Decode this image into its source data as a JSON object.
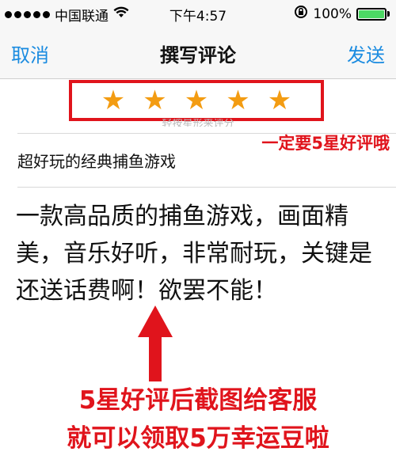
{
  "status_bar": {
    "carrier": "中国联通",
    "time": "下午4:57",
    "battery_percent": "100%",
    "battery_level": 1.0,
    "signal_dots": 5,
    "icons": [
      "wifi-icon",
      "rotation-lock-icon",
      "battery-icon"
    ]
  },
  "nav": {
    "cancel_label": "取消",
    "title": "撰写评论",
    "send_label": "发送"
  },
  "rating": {
    "stars": 5,
    "max_stars": 5,
    "hint": "轻按星形来评分",
    "star_color": "#f39c12",
    "highlight_color": "#e0141c"
  },
  "review": {
    "title": "超好玩的经典捕鱼游戏",
    "body": "一款高品质的捕鱼游戏，画面精美，音乐好听，非常耐玩，关键是还送话费啊！欲罢不能！"
  },
  "annotations": {
    "top": "一定要5星好评哦",
    "bottom_line1": "5星好评后截图给客服",
    "bottom_line2": "就可以领取5万幸运豆啦",
    "color": "#e0141c"
  },
  "accent_color": "#1a8be0"
}
